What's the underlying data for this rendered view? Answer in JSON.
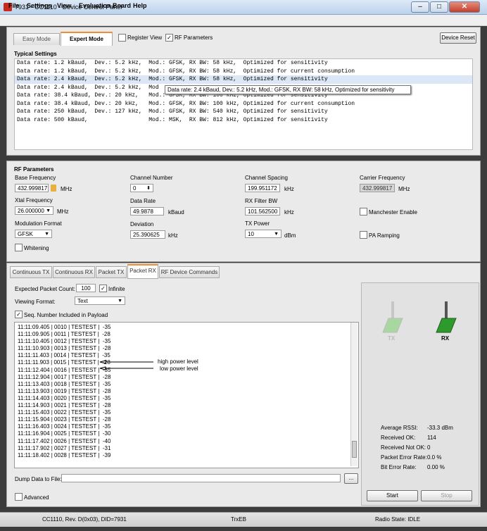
{
  "window": {
    "title": "7931 - CC1110 - Device Control Panel",
    "minimize": "–",
    "maximize": "□",
    "close": "✕"
  },
  "menu": [
    "File",
    "Settings",
    "View",
    "Evaluation Board",
    "Help"
  ],
  "mode_tabs": {
    "easy": "Easy Mode",
    "expert": "Expert Mode",
    "active": "Expert Mode"
  },
  "view_options": {
    "register_view": "Register View",
    "register_view_checked": false,
    "rf_parameters": "RF Parameters",
    "rf_parameters_checked": true
  },
  "device_reset": "Device Reset",
  "typical_settings": {
    "title": "Typical Settings",
    "rows": [
      "Data rate: 1.2 kBaud,  Dev.: 5.2 kHz,  Mod.: GFSK, RX BW: 58 kHz,  Optimized for sensitivity",
      "Data rate: 1.2 kBaud,  Dev.: 5.2 kHz,  Mod.: GFSK, RX BW: 58 kHz,  Optimized for current consumption",
      "Data rate: 2.4 kBaud,  Dev.: 5.2 kHz,  Mod.: GFSK, RX BW: 58 kHz,  Optimized for sensitivity",
      "Data rate: 2.4 kBaud,  Dev.: 5.2 kHz,  Mod",
      "Data rate: 38.4 kBaud, Dev.: 20 kHz,   Mod.: GFSK, RX BW: 100 kHz, Optimized for sensitivity",
      "Data rate: 38.4 kBaud, Dev.: 20 kHz,   Mod.: GFSK, RX BW: 100 kHz, Optimized for current consumption",
      "Data rate: 250 kBaud,  Dev.: 127 kHz,  Mod.: GFSK, RX BW: 540 kHz, Optimized for sensitivity",
      "Data rate: 500 kBaud,                  Mod.: MSK,  RX BW: 812 kHz, Optimized for sensitivity"
    ],
    "selected_index": 2,
    "tooltip": "Data rate: 2.4 kBaud, Dev.: 5.2 kHz, Mod.: GFSK, RX BW: 58 kHz, Optimized for sensitivity"
  },
  "rf_parameters": {
    "title": "RF Parameters",
    "base_frequency": {
      "label": "Base Frequency",
      "value": "432.999817",
      "unit": "MHz"
    },
    "channel_number": {
      "label": "Channel Number",
      "value": "0"
    },
    "channel_spacing": {
      "label": "Channel Spacing",
      "value": "199.951172",
      "unit": "kHz"
    },
    "carrier_frequency": {
      "label": "Carrier Frequency",
      "value": "432.999817",
      "unit": "MHz"
    },
    "xtal_frequency": {
      "label": "Xtal Frequency",
      "value": "26.000000",
      "unit": "MHz"
    },
    "data_rate": {
      "label": "Data Rate",
      "value": "49.9878",
      "unit": "kBaud"
    },
    "rx_filter_bw": {
      "label": "RX Filter BW",
      "value": "101.562500",
      "unit": "kHz"
    },
    "manchester": {
      "label": "Manchester Enable",
      "checked": false
    },
    "modulation_format": {
      "label": "Modulation Format",
      "value": "GFSK"
    },
    "deviation": {
      "label": "Deviation",
      "value": "25.390625",
      "unit": "kHz"
    },
    "tx_power": {
      "label": "TX Power",
      "value": "10",
      "unit": "dBm"
    },
    "pa_ramping": {
      "label": "PA Ramping",
      "checked": false
    },
    "whitening": {
      "label": "Whitening",
      "checked": false
    }
  },
  "bottom_tabs": [
    "Continuous TX",
    "Continuous RX",
    "Packet TX",
    "Packet RX",
    "RF Device Commands"
  ],
  "active_bottom_tab": "Packet RX",
  "packet_rx": {
    "expected_count_label": "Expected Packet Count:",
    "expected_count": "100",
    "infinite_label": "Infinite",
    "infinite_checked": true,
    "viewing_format_label": "Viewing Format:",
    "viewing_format": "Text",
    "seq_label": "Seq. Number Included in Payload",
    "seq_checked": true,
    "log": [
      "11:11:09.405 | 0010 | TESTEST |  -35",
      "11:11:09.905 | 0011 | TESTEST |  -28",
      "11:11:10.405 | 0012 | TESTEST |  -35",
      "11:11:10.903 | 0013 | TESTEST |  -28",
      "11:11:11.403 | 0014 | TESTEST |  -35",
      "11:11:11.903 | 0015 | TESTEST |  -28",
      "11:11:12.404 | 0016 | TESTEST |  -35",
      "11:11:12.904 | 0017 | TESTEST |  -28",
      "11:11:13.403 | 0018 | TESTEST |  -35",
      "11:11:13.903 | 0019 | TESTEST |  -28",
      "11:11:14.403 | 0020 | TESTEST |  -35",
      "11:11:14.903 | 0021 | TESTEST |  -28",
      "11:11:15.403 | 0022 | TESTEST |  -35",
      "11:11:15.904 | 0023 | TESTEST |  -28",
      "11:11:16.403 | 0024 | TESTEST |  -35",
      "11:11:16.904 | 0025 | TESTEST |  -30",
      "11:11:17.402 | 0026 | TESTEST |  -40",
      "11:11:17.902 | 0027 | TESTEST |  -31",
      "11:11:18.402 | 0028 | TESTEST |  -39"
    ],
    "annotation_high": "high power level",
    "annotation_low": "low power level",
    "dump_label": "Dump Data to File:",
    "dump_value": "",
    "browse": "...",
    "advanced_label": "Advanced",
    "advanced_checked": false
  },
  "radio_panel": {
    "tx_label": "TX",
    "rx_label": "RX",
    "avg_rssi_label": "Average RSSI:",
    "avg_rssi": "-33.3 dBm",
    "received_ok_label": "Received OK:",
    "received_ok": "114",
    "received_not_ok_label": "Received Not OK:",
    "received_not_ok": "0",
    "per_label": "Packet Error Rate:",
    "per": "0.0 %",
    "ber_label": "Bit Error Rate:",
    "ber": "0.00 %",
    "start": "Start",
    "stop": "Stop"
  },
  "status": {
    "device": "CC1110, Rev. D(0x03), DID=7931",
    "board": "TrxEB",
    "radio_state": "Radio State: IDLE"
  },
  "colors": {
    "accent": "#f08c34",
    "rx_green": "#2e9a2e",
    "tx_green_faded": "#a8d8a0"
  }
}
